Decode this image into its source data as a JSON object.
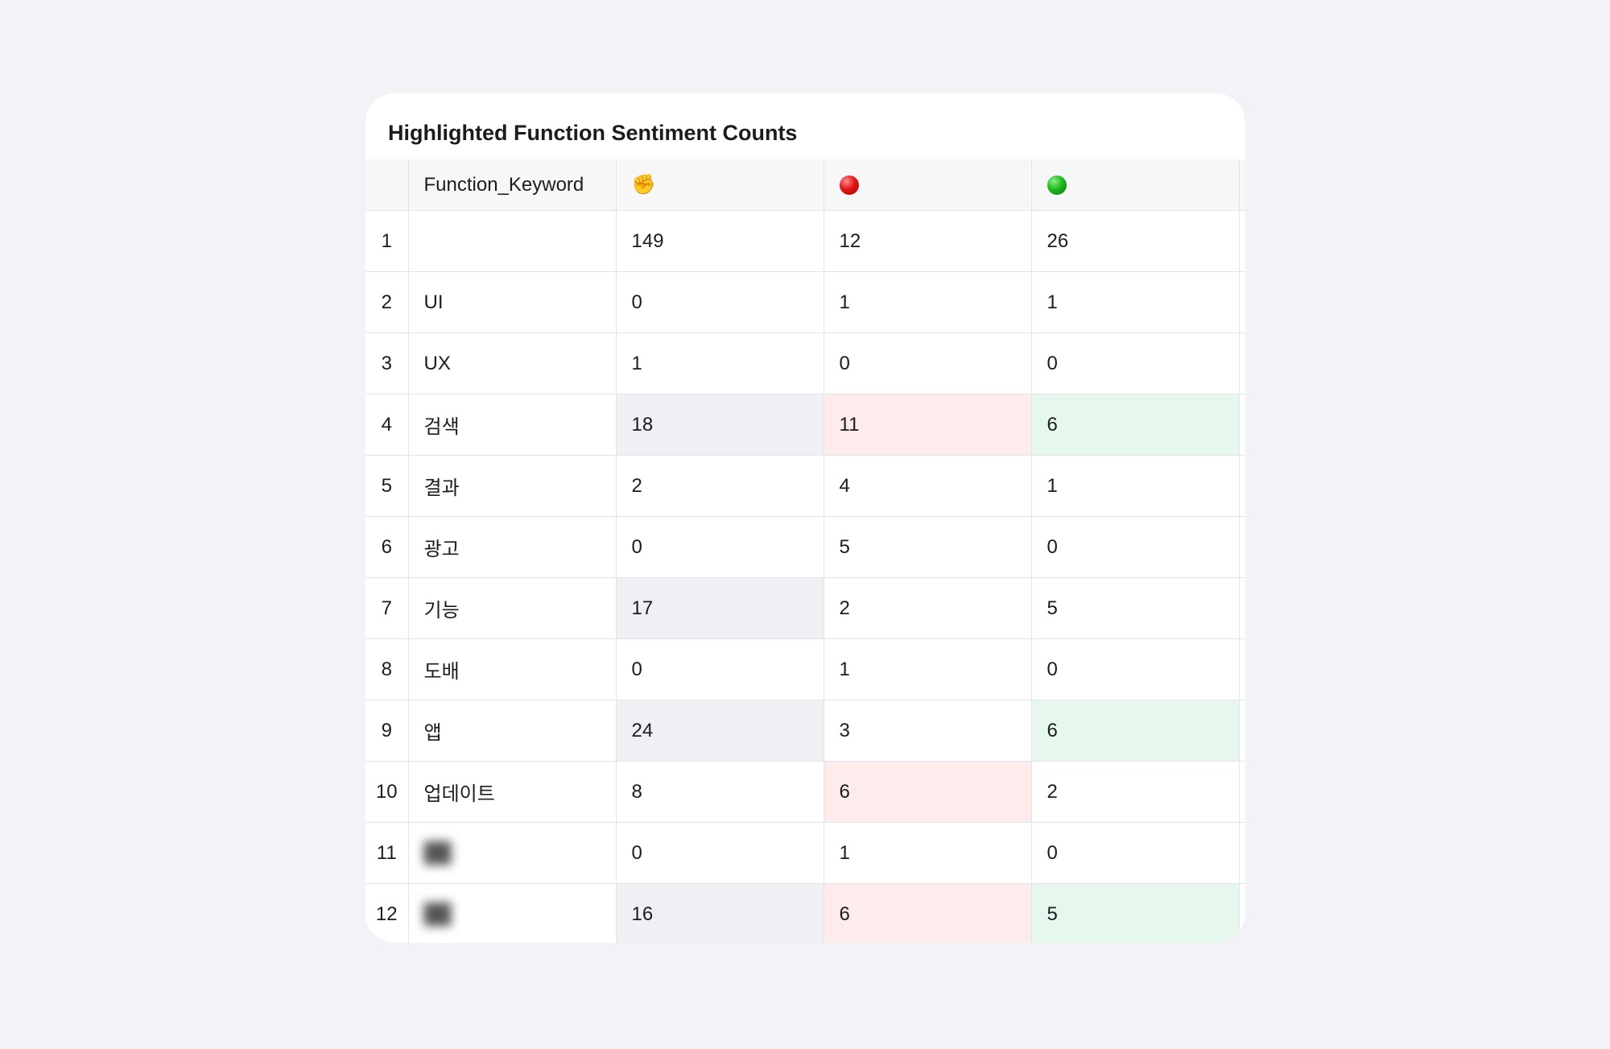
{
  "card": {
    "title": "Highlighted Function Sentiment Counts"
  },
  "table": {
    "headers": {
      "index": "",
      "keyword": "Function_Keyword",
      "col_a_icon": "fist-icon",
      "col_b_icon": "red-circle-icon",
      "col_c_icon": "green-circle-icon"
    },
    "icon_colors": {
      "red_circle": "#e01818",
      "green_circle": "#1fb81f"
    },
    "highlight_colors": {
      "gray": "#efeff4",
      "red": "#fdeceb",
      "green": "#e6f8ee"
    },
    "rows": [
      {
        "index": "1",
        "keyword": "",
        "a": "149",
        "b": "12",
        "c": "26"
      },
      {
        "index": "2",
        "keyword": "UI",
        "a": "0",
        "b": "1",
        "c": "1"
      },
      {
        "index": "3",
        "keyword": "UX",
        "a": "1",
        "b": "0",
        "c": "0"
      },
      {
        "index": "4",
        "keyword": "검색",
        "a": "18",
        "b": "11",
        "c": "6"
      },
      {
        "index": "5",
        "keyword": "결과",
        "a": "2",
        "b": "4",
        "c": "1"
      },
      {
        "index": "6",
        "keyword": "광고",
        "a": "0",
        "b": "5",
        "c": "0"
      },
      {
        "index": "7",
        "keyword": "기능",
        "a": "17",
        "b": "2",
        "c": "5"
      },
      {
        "index": "8",
        "keyword": "도배",
        "a": "0",
        "b": "1",
        "c": "0"
      },
      {
        "index": "9",
        "keyword": "앱",
        "a": "24",
        "b": "3",
        "c": "6"
      },
      {
        "index": "10",
        "keyword": "업데이트",
        "a": "8",
        "b": "6",
        "c": "2"
      },
      {
        "index": "11",
        "keyword": "",
        "a": "0",
        "b": "1",
        "c": "0"
      },
      {
        "index": "12",
        "keyword": "",
        "a": "16",
        "b": "6",
        "c": "5"
      }
    ]
  }
}
